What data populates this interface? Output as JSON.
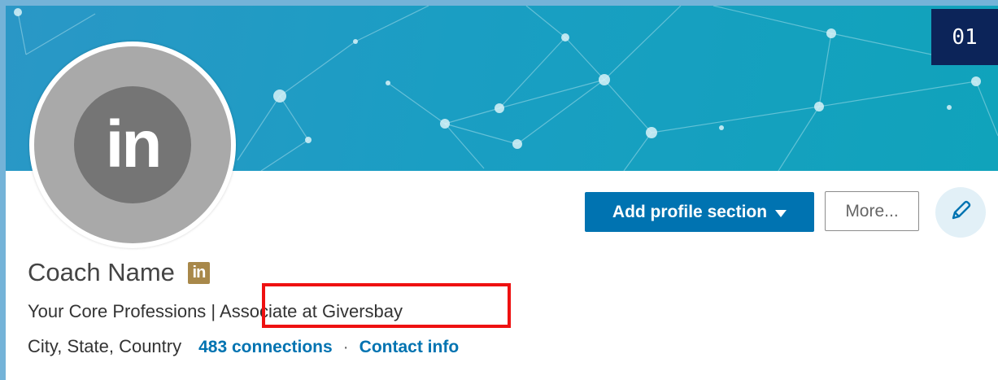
{
  "slide_number": "01",
  "profile": {
    "avatar_logo": "in",
    "name": "Coach Name",
    "member_badge": "in",
    "headline_part1": "Your Core Professions | ",
    "headline_part2": "Associate at Giversbay",
    "location": "City, State, Country",
    "connections": "483 connections",
    "separator": "·",
    "contact_info": "Contact info"
  },
  "actions": {
    "add_section_label": "Add profile section",
    "add_section_icon": "caret-down-icon",
    "more_label": "More...",
    "edit_icon": "pencil-icon"
  },
  "colors": {
    "primary_button": "#0073b1",
    "link": "#0073b1",
    "highlight_box": "#ee1111",
    "badge_background": "#0c2459",
    "premium_badge": "#a8884a"
  }
}
